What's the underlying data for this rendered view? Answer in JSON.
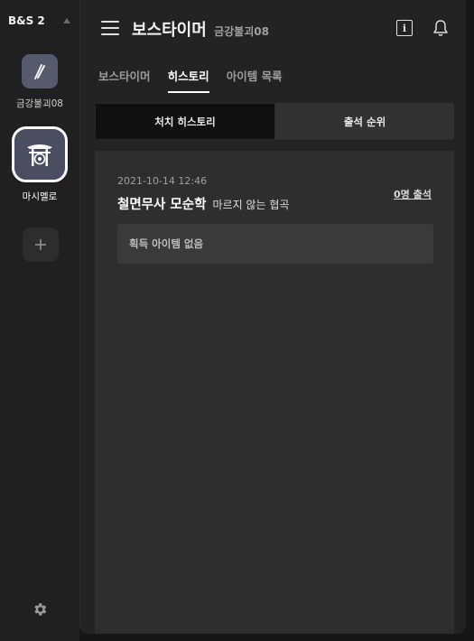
{
  "app": {
    "title": "B&S 2"
  },
  "servers": [
    {
      "label": "금강불괴08"
    },
    {
      "label": "마시멜로"
    }
  ],
  "header": {
    "title": "보스타이머",
    "subtitle": "금강불괴08"
  },
  "tabs": [
    {
      "label": "보스타이머",
      "active": false
    },
    {
      "label": "히스토리",
      "active": true
    },
    {
      "label": "아이템 목록",
      "active": false
    }
  ],
  "segments": [
    {
      "label": "처치 히스토리",
      "active": true
    },
    {
      "label": "출석 순위",
      "active": false
    }
  ],
  "history": [
    {
      "datetime": "2021-10-14 12:46",
      "boss_name": "철면무사 모순학",
      "description": "마르지 않는 협곡",
      "attendance": "0명 출석",
      "loot": "획득 아이템 없음"
    }
  ],
  "icons": {
    "menu": "hamburger-menu-icon",
    "info": "info-icon",
    "bell": "bell-icon",
    "settings": "gear-icon",
    "add": "plus-icon"
  },
  "colors": {
    "background": "#161616",
    "panel": "#232323",
    "card": "#2e2e2e",
    "accent": "#ffffff"
  }
}
